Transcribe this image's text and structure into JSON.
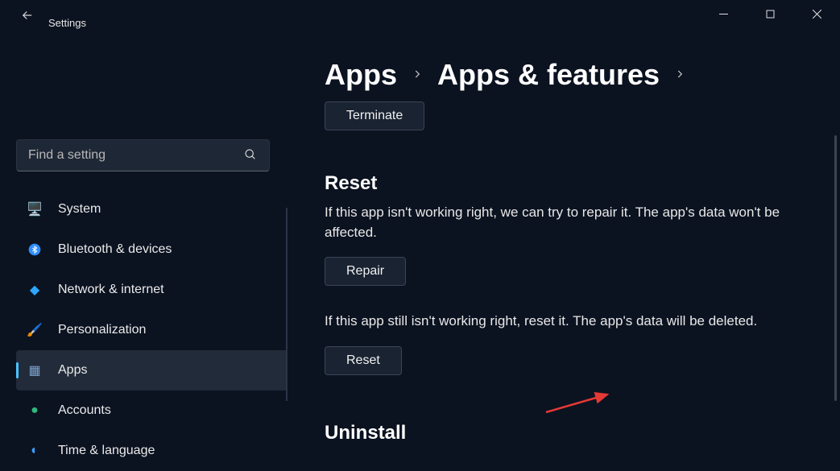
{
  "app_title": "Settings",
  "search": {
    "placeholder": "Find a setting"
  },
  "nav": [
    {
      "label": "System",
      "icon": "🖥️",
      "color": "#4aa3ff"
    },
    {
      "label": "Bluetooth & devices",
      "icon": "bt",
      "color": "#2e8eff"
    },
    {
      "label": "Network & internet",
      "icon": "◆",
      "color": "#2ea6ff"
    },
    {
      "label": "Personalization",
      "icon": "🖌️",
      "color": "#c48a5a"
    },
    {
      "label": "Apps",
      "icon": "▦",
      "color": "#7aa0c9",
      "active": true
    },
    {
      "label": "Accounts",
      "icon": "●",
      "color": "#2fb97a"
    },
    {
      "label": "Time & language",
      "icon": "◐",
      "color": "#3aa0ff"
    }
  ],
  "breadcrumb": {
    "level1": "Apps",
    "level2": "Apps & features"
  },
  "actions": {
    "terminate_label": "Terminate",
    "reset_heading": "Reset",
    "repair_desc": "If this app isn't working right, we can try to repair it. The app's data won't be affected.",
    "repair_label": "Repair",
    "reset_desc": "If this app still isn't working right, reset it. The app's data will be deleted.",
    "reset_label": "Reset",
    "uninstall_heading": "Uninstall"
  }
}
